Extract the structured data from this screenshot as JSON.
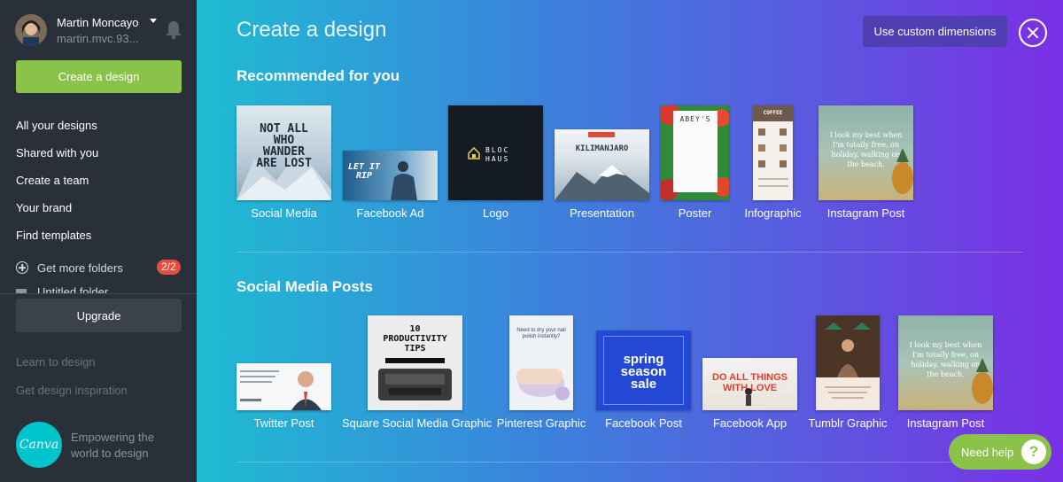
{
  "user": {
    "name": "Martin Moncayo",
    "email": "martin.mvc.93..."
  },
  "sidebar": {
    "create_label": "Create a design",
    "items": [
      {
        "label": "All your designs"
      },
      {
        "label": "Shared with you"
      },
      {
        "label": "Create a team"
      },
      {
        "label": "Your brand"
      },
      {
        "label": "Find templates"
      }
    ],
    "folders_label": "Get more folders",
    "folders_badge": "2/2",
    "untitled_folder": "Untitled folder",
    "upgrade_label": "Upgrade",
    "learn_label": "Learn to design",
    "inspiration_label": "Get design inspiration",
    "logo_text": "Canva",
    "tagline": "Empowering the world to design"
  },
  "main": {
    "title": "Create a design",
    "custom_dimensions_label": "Use custom dimensions",
    "sections": [
      {
        "title": "Recommended for you",
        "cards": [
          {
            "label": "Social Media"
          },
          {
            "label": "Facebook Ad"
          },
          {
            "label": "Logo"
          },
          {
            "label": "Presentation"
          },
          {
            "label": "Poster"
          },
          {
            "label": "Infographic"
          },
          {
            "label": "Instagram Post"
          }
        ]
      },
      {
        "title": "Social Media Posts",
        "cards": [
          {
            "label": "Twitter Post"
          },
          {
            "label": "Square Social Media Graphic"
          },
          {
            "label": "Pinterest Graphic"
          },
          {
            "label": "Facebook Post"
          },
          {
            "label": "Facebook App"
          },
          {
            "label": "Tumblr Graphic"
          },
          {
            "label": "Instagram Post"
          }
        ]
      }
    ]
  },
  "thumbs": {
    "social_media": "NOT ALL WHO WANDER ARE LOST",
    "facebook_ad": "LET IT RIP",
    "logo": "BLOC HAUS",
    "presentation": "KILIMANJARO",
    "poster": "ABEY'S",
    "infographic": "COFFEE",
    "instagram": "I look my best when I'm totally free, on holiday, walking on the beach.",
    "square_social": "10 PRODUCTIVITY TIPS",
    "pinterest": "Need to dry your nail polish instantly?",
    "facebook_post": "spring season sale",
    "facebook_app": "DO ALL THINGS WITH LOVE"
  },
  "help_label": "Need help",
  "colors": {
    "accent_green": "#8bc34a",
    "sidebar_bg": "#293039",
    "badge_red": "#e84c3d"
  }
}
